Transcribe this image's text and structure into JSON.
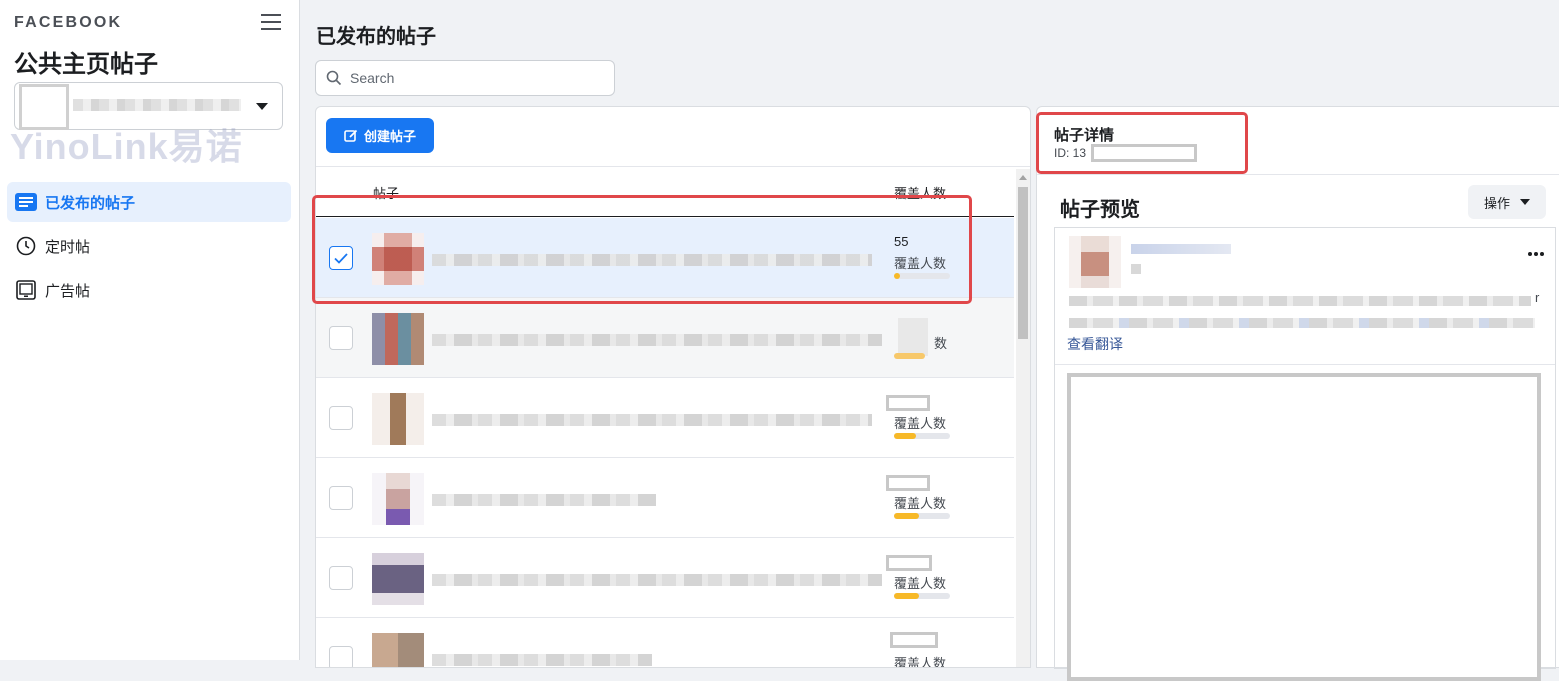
{
  "sidebar": {
    "brand": "FACEBOOK",
    "title": "公共主页帖子",
    "page_name_redacted": "—",
    "watermark": "YinoLink易诺",
    "items": [
      {
        "label": "已发布的帖子",
        "icon": "list-icon",
        "active": true
      },
      {
        "label": "定时帖",
        "icon": "clock-icon",
        "active": false
      },
      {
        "label": "广告帖",
        "icon": "tablet-icon",
        "active": false
      }
    ]
  },
  "main": {
    "title": "已发布的帖子",
    "search_placeholder": "Search",
    "create_button": "创建帖子",
    "columns": {
      "post": "帖子",
      "reach": "覆盖人数"
    },
    "rows": [
      {
        "reach": "55",
        "reach_label": "覆盖人数",
        "reach_fraction": 0.1,
        "selected": true
      },
      {
        "reach": "",
        "reach_label": "数",
        "reach_fraction": 0.55,
        "selected": false
      },
      {
        "reach": "",
        "reach_label": "覆盖人数",
        "reach_fraction": 0.4,
        "selected": false
      },
      {
        "reach": "",
        "reach_label": "覆盖人数",
        "reach_fraction": 0.45,
        "selected": false
      },
      {
        "reach": "",
        "reach_label": "覆盖人数",
        "reach_fraction": 0.45,
        "selected": false
      },
      {
        "reach": "",
        "reach_label": "覆盖人数",
        "reach_fraction": 0.4,
        "selected": false
      }
    ]
  },
  "detail": {
    "title": "帖子详情",
    "id_prefix": "ID: 13",
    "preview_title": "帖子预览",
    "action_button": "操作",
    "translate_link": "查看翻译",
    "trailing_char": "r"
  },
  "colors": {
    "accent": "#1877f2",
    "highlight": "#e0474a",
    "reach_bar": "#f7b928"
  }
}
